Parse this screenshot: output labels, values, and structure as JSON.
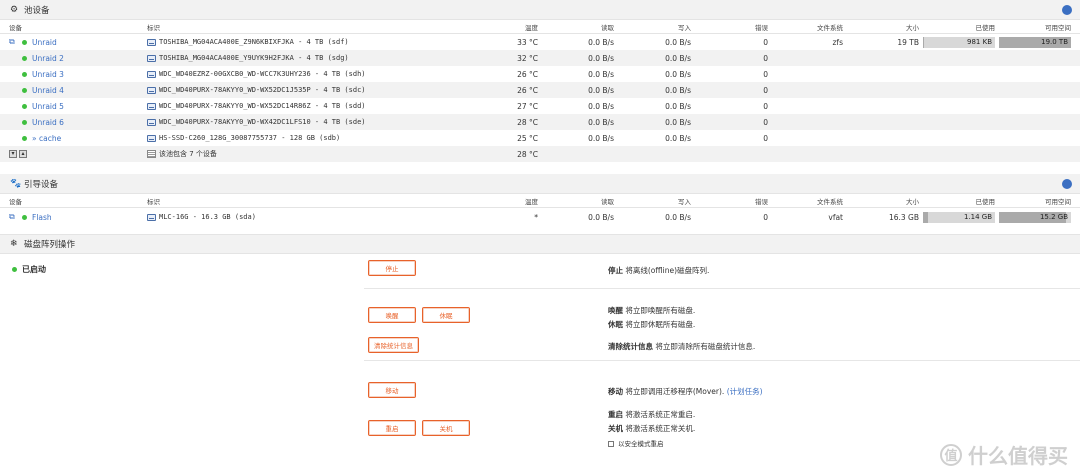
{
  "pool": {
    "title": "池设备",
    "icon": "gear-icon",
    "headers": {
      "device": "设备",
      "id": "标识",
      "temp": "温度",
      "read": "读取",
      "write": "写入",
      "errors": "错误",
      "fs": "文件系统",
      "size": "大小",
      "used": "已使用",
      "free": "可用空间"
    },
    "rows": [
      {
        "name": "Unraid",
        "id": "TOSHIBA_MG04ACA400E_Z9N6KBIXFJKA - 4 TB (sdf)",
        "temp": "33 °C",
        "read": "0.0 B/s",
        "write": "0.0 B/s",
        "errors": "0",
        "fs": "zfs",
        "size": "19 TB",
        "used": "981 KB",
        "free": "19.0 TB",
        "used_fraction": 0.0,
        "free_fraction": 1.0
      },
      {
        "name": "Unraid 2",
        "id": "TOSHIBA_MG04ACA400E_Y9UYK9H2FJKA - 4 TB (sdg)",
        "temp": "32 °C",
        "read": "0.0 B/s",
        "write": "0.0 B/s",
        "errors": "0"
      },
      {
        "name": "Unraid 3",
        "id": "WDC_WD40EZRZ-00GXCB0_WD-WCC7K3UHY236 - 4 TB (sdh)",
        "temp": "26 °C",
        "read": "0.0 B/s",
        "write": "0.0 B/s",
        "errors": "0"
      },
      {
        "name": "Unraid 4",
        "id": "WDC_WD40PURX-78AKYY0_WD-WX52DC1J535P - 4 TB (sdc)",
        "temp": "26 °C",
        "read": "0.0 B/s",
        "write": "0.0 B/s",
        "errors": "0"
      },
      {
        "name": "Unraid 5",
        "id": "WDC_WD40PURX-78AKYY0_WD-WX52DC14R86Z - 4 TB (sdd)",
        "temp": "27 °C",
        "read": "0.0 B/s",
        "write": "0.0 B/s",
        "errors": "0"
      },
      {
        "name": "Unraid 6",
        "id": "WDC_WD40PURX-78AKYY0_WD-WX42DC1LFS10 - 4 TB (sde)",
        "temp": "28 °C",
        "read": "0.0 B/s",
        "write": "0.0 B/s",
        "errors": "0"
      },
      {
        "name": "» cache",
        "id": "HS-SSD-C260_128G_30087755737 - 128 GB (sdb)",
        "temp": "25 °C",
        "read": "0.0 B/s",
        "write": "0.0 B/s",
        "errors": "0"
      }
    ],
    "summary": {
      "id": "该池包含 7 个设备",
      "temp": "28 °C"
    }
  },
  "boot": {
    "title": "引导设备",
    "icon": "paw-icon",
    "rows": [
      {
        "name": "Flash",
        "id": "MLC-16G - 16.3 GB (sda)",
        "temp": "*",
        "read": "0.0 B/s",
        "write": "0.0 B/s",
        "errors": "0",
        "fs": "vfat",
        "size": "16.3 GB",
        "used": "1.14 GB",
        "free": "15.2 GB",
        "used_fraction": 0.07,
        "free_fraction": 0.93
      }
    ]
  },
  "array_ops": {
    "title": "磁盘阵列操作",
    "icon": "snowflake-icon",
    "status": "已启动",
    "buttons": {
      "stop": "停止",
      "spin_up": "唤醒",
      "spin_down": "休眠",
      "clear_stats": "清除统计信息",
      "move": "移动",
      "reboot": "重启",
      "shutdown": "关机"
    },
    "desc": {
      "stop_b": "停止",
      "stop_t": " 将离线(offline)磁盘阵列.",
      "spinup_b": "唤醒",
      "spinup_t": " 将立即唤醒所有磁盘.",
      "spindown_b": "休眠",
      "spindown_t": " 将立即休眠所有磁盘.",
      "clear_b": "清除统计信息",
      "clear_t": " 将立即清除所有磁盘统计信息.",
      "move_b": "移动",
      "move_t": " 将立即调用迁移程序(Mover). ",
      "move_link": "(计划任务)",
      "reboot_b": "重启",
      "reboot_t": " 将激活系统正常重启.",
      "shutdown_b": "关机",
      "shutdown_t": " 将激活系统正常关机.",
      "safe_mode": "以安全模式重启"
    }
  },
  "watermark": "什么值得买"
}
